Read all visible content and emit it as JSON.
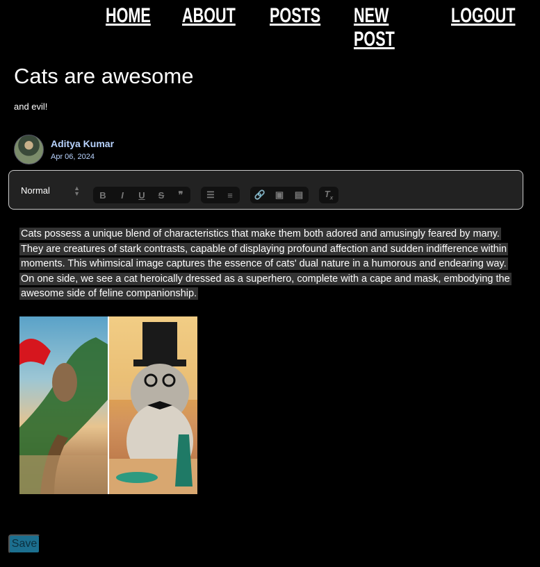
{
  "nav": {
    "items": [
      "HOME",
      "ABOUT",
      "POSTS",
      "NEW POST",
      "LOGOUT"
    ]
  },
  "post": {
    "title": "Cats are awesome",
    "subtitle": "and evil!",
    "author": "Aditya Kumar",
    "date": "Apr 06, 2024",
    "body": "Cats possess a unique blend of characteristics that make them both adored and amusingly feared by many. They are creatures of stark contrasts, capable of displaying profound affection and sudden indifference within moments. This whimsical image captures the essence of cats' dual nature in a humorous and endearing way. On one side, we see a cat heroically dressed as a superhero, complete with a cape and mask, embodying the awesome side of feline companionship."
  },
  "toolbar": {
    "format_select": "Normal",
    "icons": [
      "bold-icon",
      "italic-icon",
      "underline-icon",
      "strike-icon",
      "blockquote-icon",
      "ordered-list-icon",
      "bullet-list-icon",
      "link-icon",
      "image-icon",
      "video-icon",
      "clear-format-icon"
    ]
  },
  "actions": {
    "save_label": "Save"
  }
}
